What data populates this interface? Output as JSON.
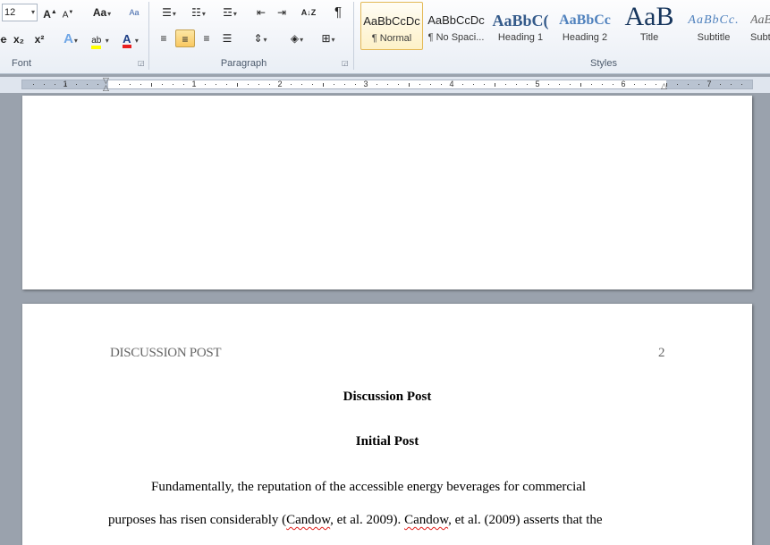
{
  "ribbon": {
    "font": {
      "size_value": "12",
      "group_label": "Font",
      "grow_glyph": "A",
      "shrink_glyph": "A",
      "case_glyph": "Aa",
      "clear_glyph": "Aa",
      "strike_glyph": "e",
      "subscript_glyph": "x₂",
      "superscript_glyph": "x²",
      "effects_glyph": "A",
      "highlight_glyph": "ab",
      "color_glyph": "A",
      "highlight_color": "#ffff00",
      "font_color": "#e81f1f"
    },
    "paragraph": {
      "group_label": "Paragraph",
      "sort_glyph": "A↓Z",
      "pilcrow_glyph": "¶"
    },
    "styles": {
      "group_label": "Styles",
      "items": [
        {
          "sample": "AaBbCcDc",
          "name": "¶ Normal"
        },
        {
          "sample": "AaBbCcDc",
          "name": "¶ No Spaci..."
        },
        {
          "sample": "AaBbC(",
          "name": "Heading 1"
        },
        {
          "sample": "AaBbCc",
          "name": "Heading 2"
        },
        {
          "sample": "AaB",
          "name": "Title"
        },
        {
          "sample": "AaBbCc.",
          "name": "Subtitle"
        },
        {
          "sample": "AaB",
          "name": "Subtle"
        }
      ]
    }
  },
  "ruler": {
    "numbers": [
      "1",
      "1",
      "2",
      "3",
      "4",
      "5",
      "6",
      "7"
    ]
  },
  "document": {
    "running_head": "DISCUSSION POST",
    "page_number": "2",
    "title": "Discussion Post",
    "subtitle": "Initial Post",
    "line1": "Fundamentally, the reputation of the accessible  energy beverages  for commercial",
    "line2_a": "purposes has risen considerably (",
    "line2_b": "Candow",
    "line2_c": ", et al. 2009). ",
    "line2_d": "Candow",
    "line2_e": ", et al. (2009) asserts that the"
  }
}
